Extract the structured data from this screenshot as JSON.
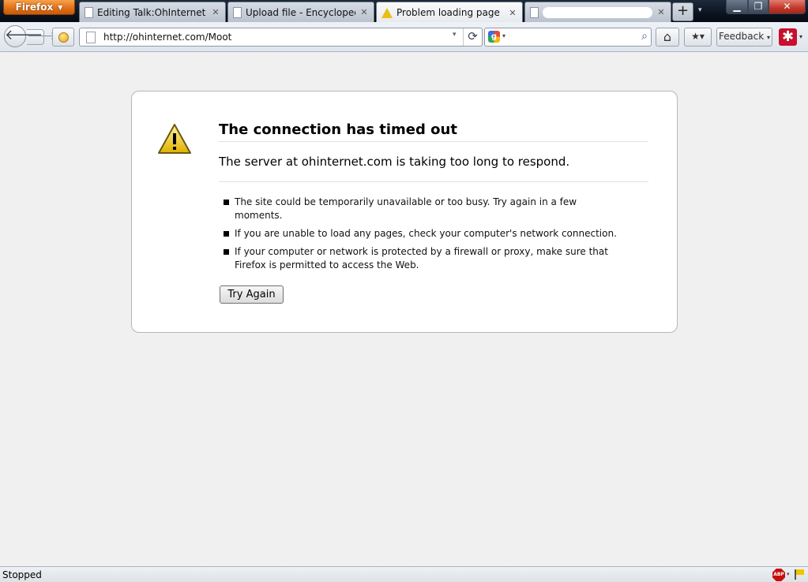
{
  "app_menu": {
    "label": "Firefox",
    "arrow": "▼"
  },
  "tabs": [
    {
      "label": "Editing Talk:OhInternet (...",
      "icon": "doc-icon",
      "close": "✕"
    },
    {
      "label": "Upload file - Encyclopedi...",
      "icon": "doc-icon",
      "close": "✕"
    },
    {
      "label": "Problem loading page",
      "icon": "warning-icon",
      "close": "✕",
      "active": true
    },
    {
      "label": "",
      "icon": "doc-icon",
      "close": "✕"
    }
  ],
  "tabstrip": {
    "new_tab": "+",
    "list_all": "▾"
  },
  "window_controls": {
    "minimize": "▁",
    "maximize": "❐",
    "close": "✕"
  },
  "nav": {
    "back": "🡐",
    "forward": "🡒",
    "url": "http://ohinternet.com/Moot",
    "url_dropmarker": "▾",
    "reload": "⟳",
    "search_placeholder": "",
    "search_engine": "g",
    "search_engine_caret": "▾",
    "search_go": "⌕",
    "home": "⌂",
    "bookmarks": "★▾",
    "feedback": "Feedback",
    "feedback_caret": "▾",
    "lastpass": "✱",
    "lastpass_caret": "▾"
  },
  "error": {
    "title": "The connection has timed out",
    "description": "The server at ohinternet.com is taking too long to respond.",
    "items": [
      "The site could be temporarily unavailable or too busy. Try again in a few moments.",
      "If you are unable to load any pages, check your computer's network connection.",
      "If your computer or network is protected by a firewall or proxy, make sure that Firefox is permitted to access the Web."
    ],
    "try_again_label": "Try Again"
  },
  "status": {
    "text": "Stopped",
    "abp": "ABP",
    "abp_caret": "▾"
  },
  "colors": {
    "accent_orange": "#e0721b",
    "warning_yellow": "#e7c013",
    "lastpass_red": "#c8102e",
    "page_bg": "#f0f0f0"
  }
}
